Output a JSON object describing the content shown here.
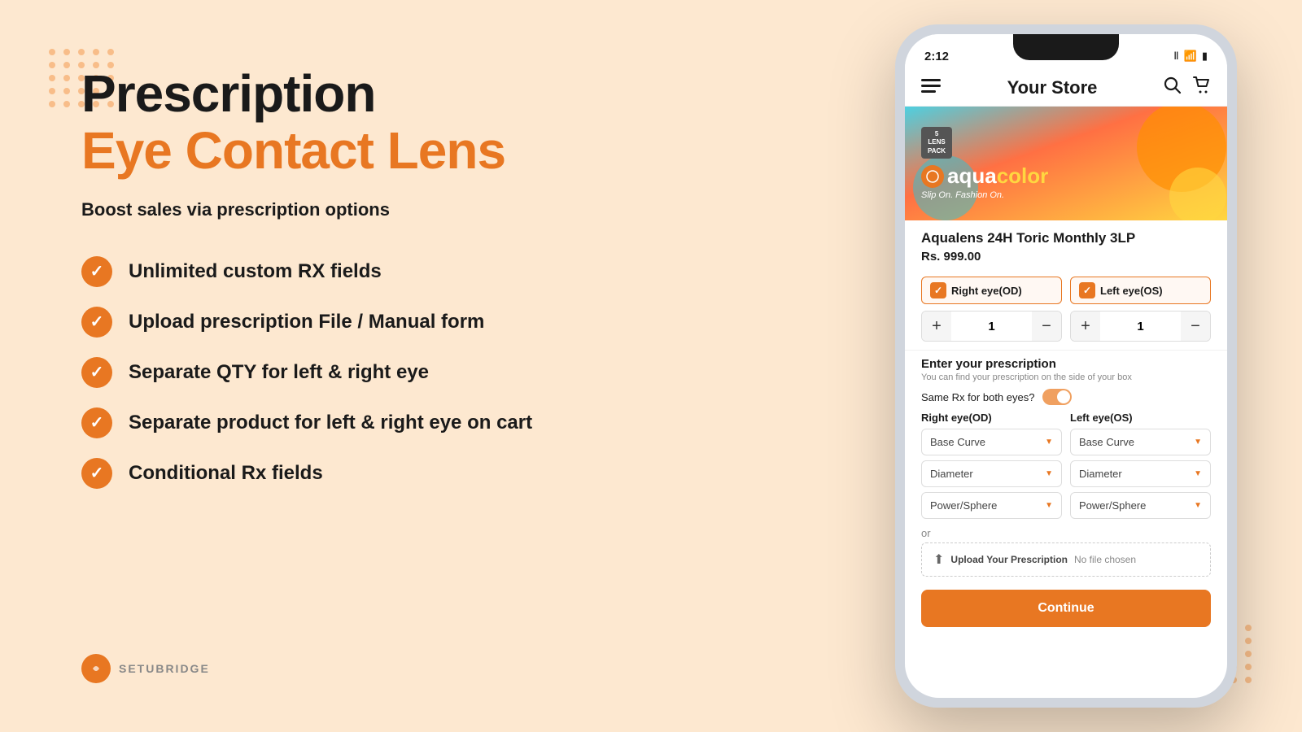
{
  "page": {
    "background": "#fde8d0"
  },
  "left": {
    "title_black": "Prescription",
    "title_orange": "Eye Contact Lens",
    "subtitle": "Boost sales via prescription options",
    "features": [
      {
        "id": "feature-1",
        "text": "Unlimited custom RX fields"
      },
      {
        "id": "feature-2",
        "text": "Upload prescription File / Manual form"
      },
      {
        "id": "feature-3",
        "text": "Separate QTY for left & right eye"
      },
      {
        "id": "feature-4",
        "text": "Separate product for left & right eye on cart"
      },
      {
        "id": "feature-5",
        "text": "Conditional Rx fields"
      }
    ]
  },
  "brand": {
    "name": "SETUBRIDGE",
    "icon": "S"
  },
  "phone": {
    "status_bar": {
      "time": "2:12",
      "signal": "📶",
      "wifi": "WiFi",
      "battery": "🔋"
    },
    "header": {
      "title": "Your Store",
      "menu_icon": "☰",
      "search_icon": "🔍",
      "cart_icon": "🛒"
    },
    "product": {
      "brand": "aquacolor",
      "brand_tagline": "Slip On. Fashion On.",
      "pack_label": "5\nLENS\nPACK",
      "name": "Aqualens 24H Toric Monthly 3LP",
      "price": "Rs. 999.00"
    },
    "eyes": {
      "right_label": "Right eye(OD)",
      "left_label": "Left eye(OS)",
      "right_qty": "1",
      "left_qty": "1",
      "plus_label": "+",
      "minus_label": "−"
    },
    "prescription": {
      "title": "Enter your prescription",
      "subtitle": "You can find your prescription on the side of your box",
      "same_rx_label": "Same Rx for both eyes?",
      "right_col_header": "Right eye(OD)",
      "left_col_header": "Left eye(OS)",
      "fields": [
        {
          "id": "base-curve",
          "label": "Base Curve"
        },
        {
          "id": "diameter",
          "label": "Diameter"
        },
        {
          "id": "power-sphere",
          "label": "Power/Sphere"
        }
      ],
      "or_text": "or",
      "upload_text": "Upload Your Prescription",
      "no_file_text": "No file chosen"
    },
    "continue_btn": "Continue"
  }
}
